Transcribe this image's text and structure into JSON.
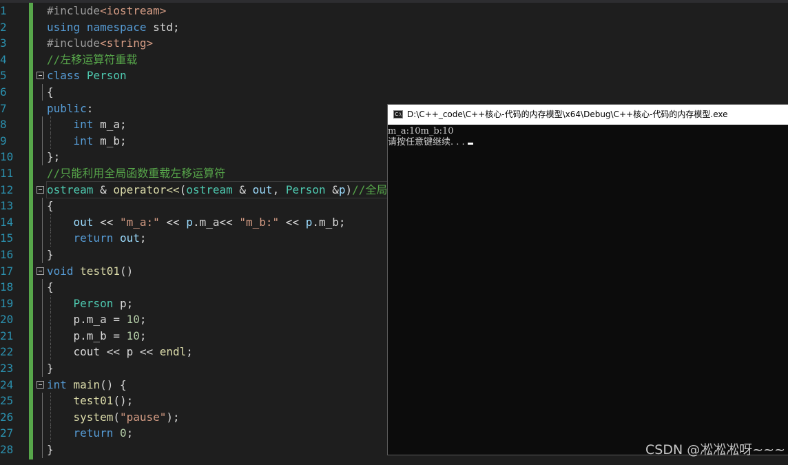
{
  "editor": {
    "lines": [
      {
        "n": "1",
        "segs": [
          {
            "t": "#include",
            "c": "pp"
          },
          {
            "t": "<iostream>",
            "c": "st"
          }
        ]
      },
      {
        "n": "2",
        "segs": [
          {
            "t": "using",
            "c": "kw"
          },
          {
            "t": " ",
            "c": "fi"
          },
          {
            "t": "namespace",
            "c": "kw"
          },
          {
            "t": " std;",
            "c": "fi"
          }
        ]
      },
      {
        "n": "3",
        "segs": [
          {
            "t": "#include",
            "c": "pp"
          },
          {
            "t": "<string>",
            "c": "st"
          }
        ]
      },
      {
        "n": "4",
        "segs": [
          {
            "t": "//左移运算符重载",
            "c": "cm"
          }
        ]
      },
      {
        "n": "5",
        "fold": true,
        "segs": [
          {
            "t": "class",
            "c": "kw"
          },
          {
            "t": " ",
            "c": "fi"
          },
          {
            "t": "Person",
            "c": "ty"
          }
        ]
      },
      {
        "n": "6",
        "guide": true,
        "segs": [
          {
            "t": "{",
            "c": "fi"
          }
        ]
      },
      {
        "n": "7",
        "segs": [
          {
            "t": "public",
            "c": "kw"
          },
          {
            "t": ":",
            "c": "fi"
          }
        ]
      },
      {
        "n": "8",
        "guide": true,
        "guide2": true,
        "segs": [
          {
            "t": "    ",
            "c": "fi"
          },
          {
            "t": "int",
            "c": "kw"
          },
          {
            "t": " m_a;",
            "c": "fi"
          }
        ]
      },
      {
        "n": "9",
        "guide": true,
        "guide2": true,
        "segs": [
          {
            "t": "    ",
            "c": "fi"
          },
          {
            "t": "int",
            "c": "kw"
          },
          {
            "t": " m_b;",
            "c": "fi"
          }
        ]
      },
      {
        "n": "10",
        "guide": true,
        "segs": [
          {
            "t": "};",
            "c": "fi"
          }
        ]
      },
      {
        "n": "11",
        "segs": [
          {
            "t": "//只能利用全局函数重载左移运算符",
            "c": "cm"
          }
        ]
      },
      {
        "n": "12",
        "fold": true,
        "hl": true,
        "segs": [
          {
            "t": "ostream",
            "c": "ty"
          },
          {
            "t": " & ",
            "c": "fi"
          },
          {
            "t": "operator<<",
            "c": "fn"
          },
          {
            "t": "(",
            "c": "fi"
          },
          {
            "t": "ostream",
            "c": "ty"
          },
          {
            "t": " & ",
            "c": "fi"
          },
          {
            "t": "out",
            "c": "pa"
          },
          {
            "t": ", ",
            "c": "fi"
          },
          {
            "t": "Person",
            "c": "ty"
          },
          {
            "t": " &",
            "c": "fi"
          },
          {
            "t": "p",
            "c": "pa"
          },
          {
            "t": ")",
            "c": "fi"
          },
          {
            "t": "//全局",
            "c": "cm"
          }
        ]
      },
      {
        "n": "13",
        "guide": true,
        "segs": [
          {
            "t": "{",
            "c": "fi"
          }
        ]
      },
      {
        "n": "14",
        "guide": true,
        "guide2": true,
        "segs": [
          {
            "t": "    ",
            "c": "fi"
          },
          {
            "t": "out",
            "c": "pa"
          },
          {
            "t": " << ",
            "c": "fi"
          },
          {
            "t": "\"m_a:\"",
            "c": "st"
          },
          {
            "t": " << ",
            "c": "fi"
          },
          {
            "t": "p",
            "c": "pa"
          },
          {
            "t": ".m_a<< ",
            "c": "fi"
          },
          {
            "t": "\"m_b:\"",
            "c": "st"
          },
          {
            "t": " << ",
            "c": "fi"
          },
          {
            "t": "p",
            "c": "pa"
          },
          {
            "t": ".m_b;",
            "c": "fi"
          }
        ]
      },
      {
        "n": "15",
        "guide": true,
        "guide2": true,
        "segs": [
          {
            "t": "    ",
            "c": "fi"
          },
          {
            "t": "return",
            "c": "kw"
          },
          {
            "t": " ",
            "c": "fi"
          },
          {
            "t": "out",
            "c": "pa"
          },
          {
            "t": ";",
            "c": "fi"
          }
        ]
      },
      {
        "n": "16",
        "guide": true,
        "segs": [
          {
            "t": "}",
            "c": "fi"
          }
        ]
      },
      {
        "n": "17",
        "fold": true,
        "segs": [
          {
            "t": "void",
            "c": "kw"
          },
          {
            "t": " ",
            "c": "fi"
          },
          {
            "t": "test01",
            "c": "fn"
          },
          {
            "t": "()",
            "c": "fi"
          }
        ]
      },
      {
        "n": "18",
        "guide": true,
        "segs": [
          {
            "t": "{",
            "c": "fi"
          }
        ]
      },
      {
        "n": "19",
        "guide": true,
        "guide2": true,
        "segs": [
          {
            "t": "    ",
            "c": "fi"
          },
          {
            "t": "Person",
            "c": "ty"
          },
          {
            "t": " ",
            "c": "fi"
          },
          {
            "t": "p",
            "c": "fi"
          },
          {
            "t": ";",
            "c": "fi"
          }
        ]
      },
      {
        "n": "20",
        "guide": true,
        "guide2": true,
        "segs": [
          {
            "t": "    p.m_a = ",
            "c": "fi"
          },
          {
            "t": "10",
            "c": "nu"
          },
          {
            "t": ";",
            "c": "fi"
          }
        ]
      },
      {
        "n": "21",
        "guide": true,
        "guide2": true,
        "segs": [
          {
            "t": "    p.m_b = ",
            "c": "fi"
          },
          {
            "t": "10",
            "c": "nu"
          },
          {
            "t": ";",
            "c": "fi"
          }
        ]
      },
      {
        "n": "22",
        "guide": true,
        "guide2": true,
        "segs": [
          {
            "t": "    cout << p << ",
            "c": "fi"
          },
          {
            "t": "endl",
            "c": "fn"
          },
          {
            "t": ";",
            "c": "fi"
          }
        ]
      },
      {
        "n": "23",
        "guide": true,
        "segs": [
          {
            "t": "}",
            "c": "fi"
          }
        ]
      },
      {
        "n": "24",
        "fold": true,
        "segs": [
          {
            "t": "int",
            "c": "kw"
          },
          {
            "t": " ",
            "c": "fi"
          },
          {
            "t": "main",
            "c": "fn"
          },
          {
            "t": "() {",
            "c": "fi"
          }
        ]
      },
      {
        "n": "25",
        "guide": true,
        "guide2": true,
        "segs": [
          {
            "t": "    ",
            "c": "fi"
          },
          {
            "t": "test01",
            "c": "fn"
          },
          {
            "t": "();",
            "c": "fi"
          }
        ]
      },
      {
        "n": "26",
        "guide": true,
        "guide2": true,
        "segs": [
          {
            "t": "    ",
            "c": "fi"
          },
          {
            "t": "system",
            "c": "fn"
          },
          {
            "t": "(",
            "c": "fi"
          },
          {
            "t": "\"pause\"",
            "c": "st"
          },
          {
            "t": ");",
            "c": "fi"
          }
        ]
      },
      {
        "n": "27",
        "guide": true,
        "guide2": true,
        "segs": [
          {
            "t": "    ",
            "c": "fi"
          },
          {
            "t": "return",
            "c": "kw"
          },
          {
            "t": " ",
            "c": "fi"
          },
          {
            "t": "0",
            "c": "nu"
          },
          {
            "t": ";",
            "c": "fi"
          }
        ]
      },
      {
        "n": "28",
        "guide": true,
        "segs": [
          {
            "t": "}",
            "c": "fi"
          }
        ]
      }
    ]
  },
  "console": {
    "icon_label": "C:\\",
    "title": "D:\\C++_code\\C++核心-代码的内存模型\\x64\\Debug\\C++核心-代码的内存模型.exe",
    "output_line1": "m_a:10m_b:10",
    "output_line2": "请按任意键继续. . ."
  },
  "watermark": "CSDN @凇凇凇呀~~~"
}
